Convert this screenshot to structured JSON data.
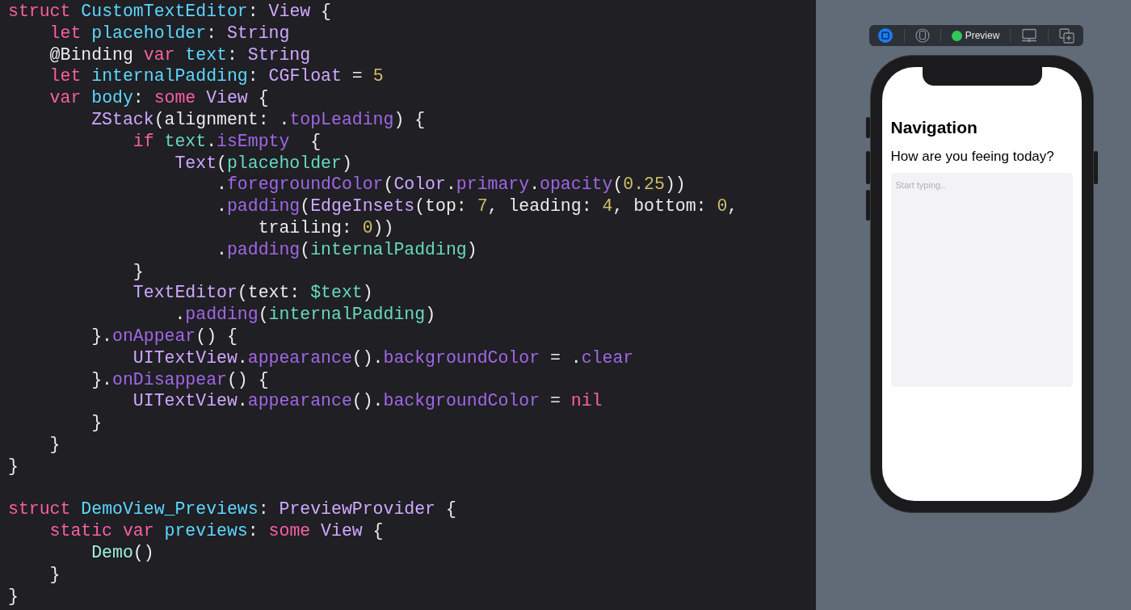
{
  "editor": {
    "blocks": [
      {
        "lines": [
          [
            {
              "kind": "kw",
              "text": "struct"
            },
            {
              "kind": "decl",
              "text": " CustomTextEditor"
            },
            {
              "kind": "p",
              "text": ": "
            },
            {
              "kind": "type",
              "text": "View"
            },
            {
              "kind": "p",
              "text": " {"
            }
          ],
          [
            {
              "kind": "kw",
              "text": "    let"
            },
            {
              "kind": "decl",
              "text": " placeholder"
            },
            {
              "kind": "p",
              "text": ": "
            },
            {
              "kind": "type",
              "text": "String"
            }
          ],
          [
            {
              "kind": "p",
              "text": "    @Binding"
            },
            {
              "kind": "kw",
              "text": " var"
            },
            {
              "kind": "decl",
              "text": " text"
            },
            {
              "kind": "p",
              "text": ": "
            },
            {
              "kind": "type",
              "text": "String"
            }
          ],
          [
            {
              "kind": "kw",
              "text": "    let"
            },
            {
              "kind": "decl",
              "text": " internalPadding"
            },
            {
              "kind": "p",
              "text": ": "
            },
            {
              "kind": "type",
              "text": "CGFloat"
            },
            {
              "kind": "p",
              "text": " = "
            },
            {
              "kind": "num",
              "text": "5"
            }
          ],
          [
            {
              "kind": "kw",
              "text": "    var"
            },
            {
              "kind": "decl",
              "text": " body"
            },
            {
              "kind": "p",
              "text": ": "
            },
            {
              "kind": "kw",
              "text": "some"
            },
            {
              "kind": "type",
              "text": " View"
            },
            {
              "kind": "p",
              "text": " {"
            }
          ],
          [
            {
              "kind": "type",
              "text": "        ZStack"
            },
            {
              "kind": "p",
              "text": "(alignment: ."
            },
            {
              "kind": "func",
              "text": "topLeading"
            },
            {
              "kind": "p",
              "text": ") {"
            }
          ],
          [
            {
              "kind": "kw",
              "text": "            if"
            },
            {
              "kind": "var",
              "text": " text"
            },
            {
              "kind": "p",
              "text": "."
            },
            {
              "kind": "func",
              "text": "isEmpty"
            },
            {
              "kind": "p",
              "text": "  {"
            }
          ],
          [
            {
              "kind": "type",
              "text": "                Text"
            },
            {
              "kind": "p",
              "text": "("
            },
            {
              "kind": "var",
              "text": "placeholder"
            },
            {
              "kind": "p",
              "text": ")"
            }
          ],
          [
            {
              "kind": "p",
              "text": "                    ."
            },
            {
              "kind": "func",
              "text": "foregroundColor"
            },
            {
              "kind": "p",
              "text": "("
            },
            {
              "kind": "type",
              "text": "Color"
            },
            {
              "kind": "p",
              "text": "."
            },
            {
              "kind": "func",
              "text": "primary"
            },
            {
              "kind": "p",
              "text": "."
            },
            {
              "kind": "func",
              "text": "opacity"
            },
            {
              "kind": "p",
              "text": "("
            },
            {
              "kind": "num",
              "text": "0.25"
            },
            {
              "kind": "p",
              "text": "))"
            }
          ],
          [
            {
              "kind": "p",
              "text": "                    ."
            },
            {
              "kind": "func",
              "text": "padding"
            },
            {
              "kind": "p",
              "text": "("
            },
            {
              "kind": "type",
              "text": "EdgeInsets"
            },
            {
              "kind": "p",
              "text": "(top: "
            },
            {
              "kind": "num",
              "text": "7"
            },
            {
              "kind": "p",
              "text": ", leading: "
            },
            {
              "kind": "num",
              "text": "4"
            },
            {
              "kind": "p",
              "text": ", bottom: "
            },
            {
              "kind": "num",
              "text": "0"
            },
            {
              "kind": "p",
              "text": ","
            }
          ],
          [
            {
              "kind": "p",
              "text": "                        trailing: "
            },
            {
              "kind": "num",
              "text": "0"
            },
            {
              "kind": "p",
              "text": "))"
            }
          ],
          [
            {
              "kind": "p",
              "text": "                    ."
            },
            {
              "kind": "func",
              "text": "padding"
            },
            {
              "kind": "p",
              "text": "("
            },
            {
              "kind": "var",
              "text": "internalPadding"
            },
            {
              "kind": "p",
              "text": ")"
            }
          ],
          [
            {
              "kind": "p",
              "text": "            }"
            }
          ],
          [
            {
              "kind": "type",
              "text": "            TextEditor"
            },
            {
              "kind": "p",
              "text": "(text: "
            },
            {
              "kind": "var",
              "text": "$text"
            },
            {
              "kind": "p",
              "text": ")"
            }
          ],
          [
            {
              "kind": "p",
              "text": "                ."
            },
            {
              "kind": "func",
              "text": "padding"
            },
            {
              "kind": "p",
              "text": "("
            },
            {
              "kind": "var",
              "text": "internalPadding"
            },
            {
              "kind": "p",
              "text": ")"
            }
          ],
          [
            {
              "kind": "p",
              "text": "        }."
            },
            {
              "kind": "func",
              "text": "onAppear"
            },
            {
              "kind": "p",
              "text": "() {"
            }
          ],
          [
            {
              "kind": "type",
              "text": "            UITextView"
            },
            {
              "kind": "p",
              "text": "."
            },
            {
              "kind": "func",
              "text": "appearance"
            },
            {
              "kind": "p",
              "text": "()."
            },
            {
              "kind": "func",
              "text": "backgroundColor"
            },
            {
              "kind": "p",
              "text": " = ."
            },
            {
              "kind": "func",
              "text": "clear"
            }
          ],
          [
            {
              "kind": "p",
              "text": "        }."
            },
            {
              "kind": "func",
              "text": "onDisappear"
            },
            {
              "kind": "p",
              "text": "() {"
            }
          ],
          [
            {
              "kind": "type",
              "text": "            UITextView"
            },
            {
              "kind": "p",
              "text": "."
            },
            {
              "kind": "func",
              "text": "appearance"
            },
            {
              "kind": "p",
              "text": "()."
            },
            {
              "kind": "func",
              "text": "backgroundColor"
            },
            {
              "kind": "p",
              "text": " = "
            },
            {
              "kind": "kw",
              "text": "nil"
            }
          ],
          [
            {
              "kind": "p",
              "text": "        }"
            }
          ],
          [
            {
              "kind": "p",
              "text": "    }"
            }
          ],
          [
            {
              "kind": "p",
              "text": "}"
            }
          ]
        ]
      },
      {
        "lines": [
          [
            {
              "kind": "kw",
              "text": "struct"
            },
            {
              "kind": "decl",
              "text": " DemoView_Previews"
            },
            {
              "kind": "p",
              "text": ": "
            },
            {
              "kind": "type",
              "text": "PreviewProvider"
            },
            {
              "kind": "p",
              "text": " {"
            }
          ],
          [
            {
              "kind": "kw",
              "text": "    static"
            },
            {
              "kind": "kw",
              "text": " var"
            },
            {
              "kind": "decl",
              "text": " previews"
            },
            {
              "kind": "p",
              "text": ": "
            },
            {
              "kind": "kw",
              "text": "some"
            },
            {
              "kind": "type",
              "text": " View"
            },
            {
              "kind": "p",
              "text": " {"
            }
          ],
          [
            {
              "kind": "ptype",
              "text": "        Demo"
            },
            {
              "kind": "p",
              "text": "()"
            }
          ],
          [
            {
              "kind": "p",
              "text": "    }"
            }
          ],
          [
            {
              "kind": "p",
              "text": "}"
            }
          ]
        ]
      }
    ]
  },
  "preview": {
    "toolbar": {
      "label": "Preview"
    },
    "screen": {
      "title": "Navigation",
      "prompt": "How are you feeing today?",
      "text_editor": {
        "placeholder": "Start typing.."
      }
    }
  }
}
